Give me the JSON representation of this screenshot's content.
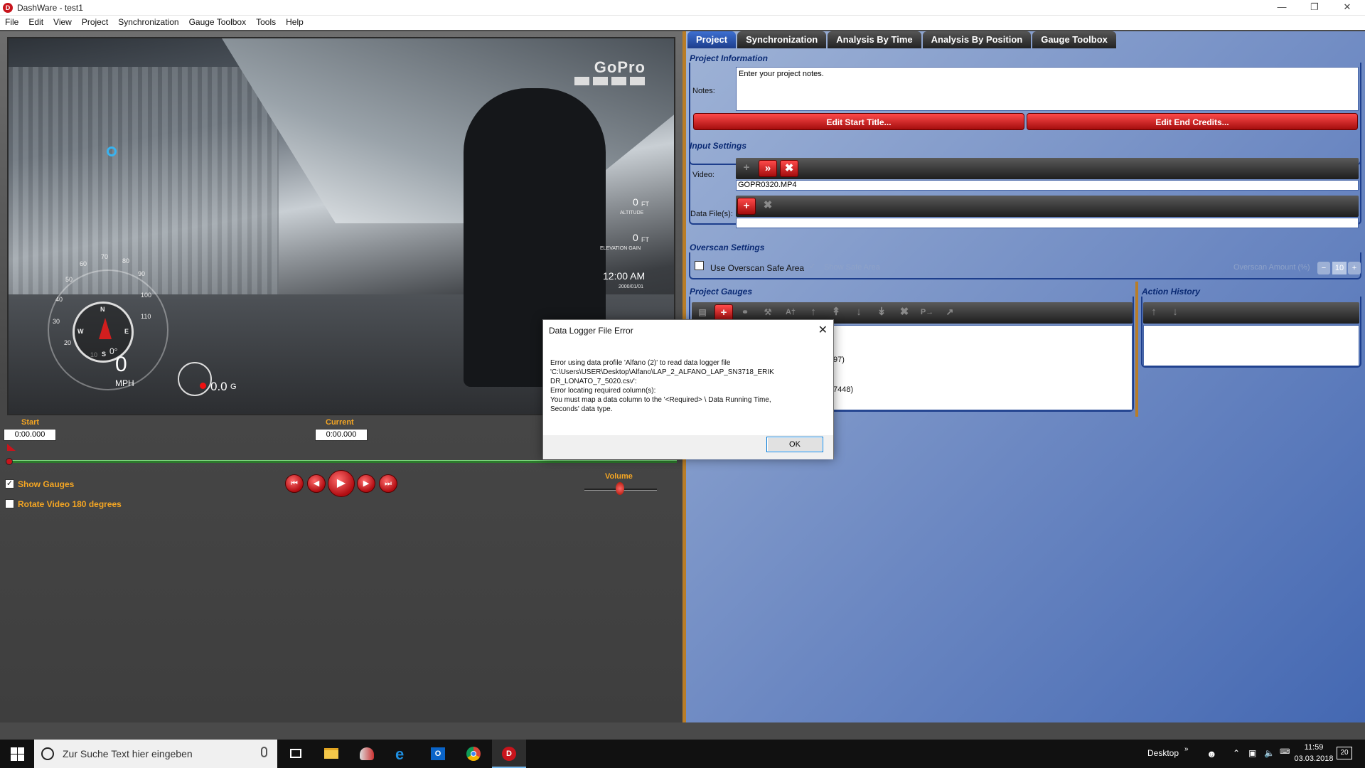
{
  "window": {
    "title": "DashWare - test1"
  },
  "menu": [
    "File",
    "Edit",
    "View",
    "Project",
    "Synchronization",
    "Gauge Toolbox",
    "Tools",
    "Help"
  ],
  "video": {
    "brand": "GoPro",
    "speed": "0",
    "speed_unit": "MPH",
    "gforce": "0.0",
    "gforce_unit": "G",
    "altitude": "0",
    "altitude_unit": "FT",
    "altitude_label": "ALTITUDE",
    "elev_gain": "0",
    "elev_gain_unit": "FT",
    "elev_gain_label": "ELEVATION GAIN",
    "time": "12:00 AM",
    "date": "2000/01/01",
    "speed_ticks": [
      "10",
      "20",
      "30",
      "40",
      "50",
      "60",
      "70",
      "80",
      "90",
      "100",
      "110"
    ],
    "compass": {
      "n": "N",
      "e": "E",
      "s": "S",
      "w": "W",
      "heading": "0°"
    }
  },
  "timeline": {
    "start_label": "Start",
    "start_value": "0:00.000",
    "current_label": "Current",
    "current_value": "0:00.000"
  },
  "controls": {
    "show_gauges": {
      "label": "Show Gauges",
      "checked": true
    },
    "rotate_video": {
      "label": "Rotate Video 180 degrees",
      "checked": false
    },
    "volume_label": "Volume",
    "volume_level": 0.5
  },
  "tabs": [
    {
      "label": "Project",
      "active": true
    },
    {
      "label": "Synchronization",
      "active": false
    },
    {
      "label": "Analysis By Time",
      "active": false
    },
    {
      "label": "Analysis By Position",
      "active": false
    },
    {
      "label": "Gauge Toolbox",
      "active": false
    }
  ],
  "project_info": {
    "title": "Project Information",
    "notes_label": "Notes:",
    "notes_placeholder": "Enter your project notes.",
    "edit_start": "Edit Start Title...",
    "edit_end": "Edit End Credits..."
  },
  "input_settings": {
    "title": "Input Settings",
    "video_label": "Video:",
    "video_file": "GOPR0320.MP4",
    "data_label": "Data File(s):",
    "data_file": ""
  },
  "overscan": {
    "title": "Overscan Settings",
    "use_label": "Use Overscan Safe Area",
    "show_label": "Show Safe Area",
    "amount_label": "Overscan Amount (%)",
    "amount_value": "10"
  },
  "project_gauges": {
    "title": "Project Gauges",
    "item1": "97)",
    "item2": "7448)"
  },
  "action_history": {
    "title": "Action History"
  },
  "dialog": {
    "title": "Data Logger File Error",
    "message": "Error using data profile 'Alfano (2)' to read data logger file\n'C:\\Users\\USER\\Desktop\\Alfano\\LAP_2_ALFANO_LAP_SN3718_ERIK\nDR_LONATO_7_5020.csv':\nError locating required column(s):\nYou must map a data column to the '<Required> \\ Data Running Time,\nSeconds' data type.",
    "ok": "OK"
  },
  "taskbar": {
    "search_placeholder": "Zur Suche Text hier eingeben",
    "desktop_label": "Desktop",
    "time": "11:59",
    "date": "03.03.2018",
    "notifications": "20"
  },
  "colors": {
    "accent_red": "#c8141c",
    "tab_active": "#1d3e8c",
    "label_orange": "#f5a623"
  }
}
